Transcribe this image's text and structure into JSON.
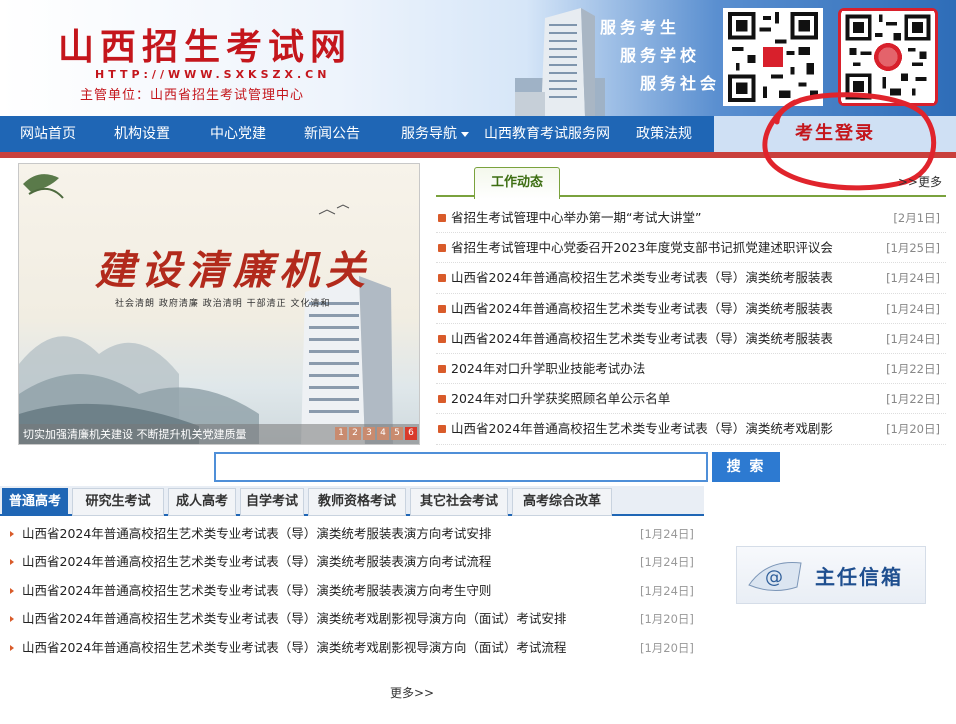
{
  "header": {
    "title": "山西招生考试网",
    "url": "HTTP://WWW.SXKSZX.CN",
    "org": "主管单位：山西省招生考试管理中心",
    "slogans": [
      "服务考生",
      "服务学校",
      "服务社会"
    ]
  },
  "nav": {
    "items": [
      {
        "label": "网站首页"
      },
      {
        "label": "机构设置"
      },
      {
        "label": "中心党建"
      },
      {
        "label": "新闻公告"
      },
      {
        "label": "服务导航"
      },
      {
        "label": "山西教育考试服务网"
      },
      {
        "label": "政策法规"
      }
    ],
    "login": "考生登录"
  },
  "slide": {
    "title": "建设清廉机关",
    "subtitle": "社会清朗  政府清廉  政治清明  干部清正  文化清和",
    "caption": "切实加强清廉机关建设 不断提升机关党建质量",
    "pages": [
      "1",
      "2",
      "3",
      "4",
      "5",
      "6"
    ],
    "active_page": 6
  },
  "news": {
    "tab": "工作动态",
    "more": ">>更多",
    "items": [
      {
        "title": "省招生考试管理中心举办第一期“考试大讲堂”",
        "date": "[2月1日]"
      },
      {
        "title": "省招生考试管理中心党委召开2023年度党支部书记抓党建述职评议会",
        "date": "[1月25日]"
      },
      {
        "title": "山西省2024年普通高校招生艺术类专业考试表（导）演类统考服装表",
        "date": "[1月24日]"
      },
      {
        "title": "山西省2024年普通高校招生艺术类专业考试表（导）演类统考服装表",
        "date": "[1月24日]"
      },
      {
        "title": "山西省2024年普通高校招生艺术类专业考试表（导）演类统考服装表",
        "date": "[1月24日]"
      },
      {
        "title": "2024年对口升学职业技能考试办法",
        "date": "[1月22日]"
      },
      {
        "title": "2024年对口升学获奖照顾名单公示名单",
        "date": "[1月22日]"
      },
      {
        "title": "山西省2024年普通高校招生艺术类专业考试表（导）演类统考戏剧影",
        "date": "[1月20日]"
      }
    ]
  },
  "search": {
    "button": "搜 索",
    "value": ""
  },
  "exam_tabs": [
    "普通高考",
    "研究生考试",
    "成人高考",
    "自学考试",
    "教师资格考试",
    "其它社会考试",
    "高考综合改革"
  ],
  "exam_list": [
    {
      "title": "山西省2024年普通高校招生艺术类专业考试表（导）演类统考服装表演方向考试安排",
      "date": "[1月24日]"
    },
    {
      "title": "山西省2024年普通高校招生艺术类专业考试表（导）演类统考服装表演方向考试流程",
      "date": "[1月24日]"
    },
    {
      "title": "山西省2024年普通高校招生艺术类专业考试表（导）演类统考服装表演方向考生守则",
      "date": "[1月24日]"
    },
    {
      "title": "山西省2024年普通高校招生艺术类专业考试表（导）演类统考戏剧影视导演方向（面试）考试安排",
      "date": "[1月20日]"
    },
    {
      "title": "山西省2024年普通高校招生艺术类专业考试表（导）演类统考戏剧影视导演方向（面试）考试流程",
      "date": "[1月20日]"
    }
  ],
  "exam_more": "更多>>",
  "mailbox": {
    "label": "主任信箱"
  },
  "colors": {
    "brand_red": "#c4161c",
    "nav_blue": "#1f66b5",
    "accent_green": "#7aa23d"
  }
}
